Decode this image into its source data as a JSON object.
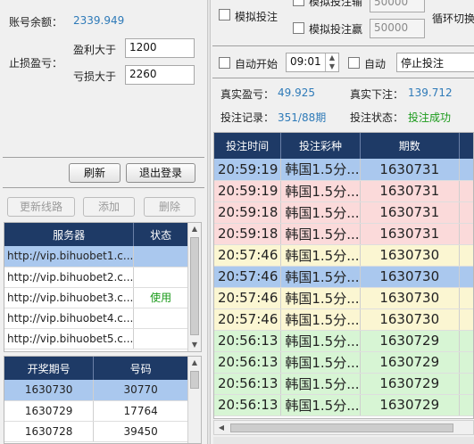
{
  "account": {
    "balance_label": "账号余额：",
    "balance_value": "2339.949"
  },
  "stoploss": {
    "group_label": "止损盈亏：",
    "profit_label": "盈利大于",
    "profit_value": "1200",
    "loss_label": "亏损大于",
    "loss_value": "2260"
  },
  "actions": {
    "refresh": "刷新",
    "logout": "退出登录"
  },
  "server_toolbar": {
    "update": "更新线路",
    "add": "添加",
    "delete": "删除"
  },
  "servers": {
    "headers": [
      "服务器",
      "状态"
    ],
    "rows": [
      {
        "url": "http://vip.bihuobet1.c...",
        "status": ""
      },
      {
        "url": "http://vip.bihuobet2.c...",
        "status": ""
      },
      {
        "url": "http://vip.bihuobet3.c...",
        "status": "使用"
      },
      {
        "url": "http://vip.bihuobet4.c...",
        "status": ""
      },
      {
        "url": "http://vip.bihuobet5.c...",
        "status": ""
      }
    ]
  },
  "draws": {
    "headers": [
      "开奖期号",
      "号码"
    ],
    "rows": [
      {
        "period": "1630730",
        "number": "30770"
      },
      {
        "period": "1630729",
        "number": "17764"
      },
      {
        "period": "1630728",
        "number": "39450"
      }
    ]
  },
  "sim": {
    "sim_bet": "模拟投注",
    "sim_lose": "模拟投注输",
    "sim_lose_value": "50000",
    "sim_win": "模拟投注赢",
    "sim_win_value": "50000",
    "loop": "循环切换"
  },
  "auto": {
    "auto_start": "自动开始",
    "time": "09:01",
    "auto": "自动",
    "stop_option": "停止投注"
  },
  "stats": {
    "real_profit_label": "真实盈亏：",
    "real_profit_value": "49.925",
    "real_bet_label": "真实下注：",
    "real_bet_value": "139.712",
    "record_label": "投注记录：",
    "record_value": "351/88期",
    "status_label": "投注状态：",
    "status_value": "投注成功"
  },
  "bets": {
    "headers": [
      "投注时间",
      "投注彩种",
      "期数"
    ],
    "rows": [
      {
        "time": "20:59:19",
        "game": "韩国1.5分...",
        "period": "1630731",
        "color": "#aac8ee"
      },
      {
        "time": "20:59:19",
        "game": "韩国1.5分...",
        "period": "1630731",
        "color": "#fbdada"
      },
      {
        "time": "20:59:18",
        "game": "韩国1.5分...",
        "period": "1630731",
        "color": "#fbdada"
      },
      {
        "time": "20:59:18",
        "game": "韩国1.5分...",
        "period": "1630731",
        "color": "#fbdada"
      },
      {
        "time": "20:57:46",
        "game": "韩国1.5分...",
        "period": "1630730",
        "color": "#fbf6d2"
      },
      {
        "time": "20:57:46",
        "game": "韩国1.5分...",
        "period": "1630730",
        "color": "#aac8ee"
      },
      {
        "time": "20:57:46",
        "game": "韩国1.5分...",
        "period": "1630730",
        "color": "#fbf6d2"
      },
      {
        "time": "20:57:46",
        "game": "韩国1.5分...",
        "period": "1630730",
        "color": "#fbf6d2"
      },
      {
        "time": "20:56:13",
        "game": "韩国1.5分...",
        "period": "1630729",
        "color": "#d7f5d4"
      },
      {
        "time": "20:56:13",
        "game": "韩国1.5分...",
        "period": "1630729",
        "color": "#d7f5d4"
      },
      {
        "time": "20:56:13",
        "game": "韩国1.5分...",
        "period": "1630729",
        "color": "#d7f5d4"
      },
      {
        "time": "20:56:13",
        "game": "韩国1.5分...",
        "period": "1630729",
        "color": "#d7f5d4"
      }
    ]
  }
}
